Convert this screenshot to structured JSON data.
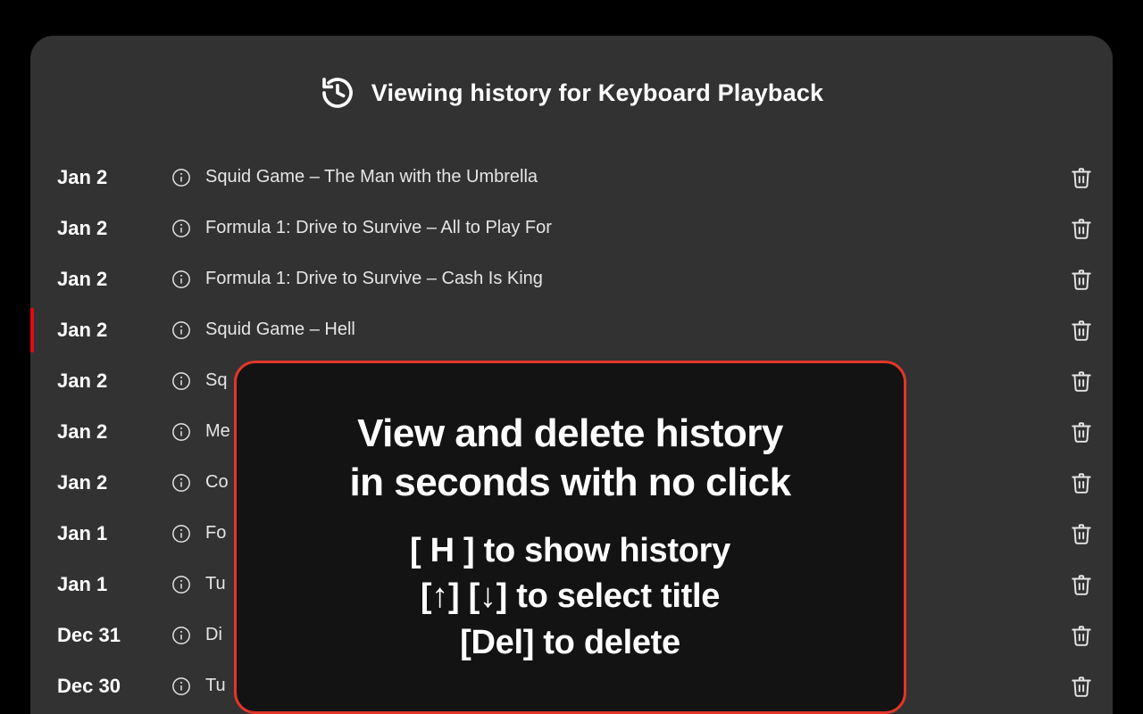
{
  "header": {
    "title": "Viewing history for Keyboard Playback"
  },
  "rows": [
    {
      "date": "Jan 2",
      "title": "Squid Game – The Man with the Umbrella",
      "selected": false
    },
    {
      "date": "Jan 2",
      "title": "Formula 1: Drive to Survive – All to Play For",
      "selected": false
    },
    {
      "date": "Jan 2",
      "title": "Formula 1: Drive to Survive – Cash Is King",
      "selected": false
    },
    {
      "date": "Jan 2",
      "title": "Squid Game – Hell",
      "selected": true
    },
    {
      "date": "Jan 2",
      "title": "Sq",
      "selected": false
    },
    {
      "date": "Jan 2",
      "title": "Me",
      "selected": false
    },
    {
      "date": "Jan 2",
      "title": "Co",
      "selected": false
    },
    {
      "date": "Jan 1",
      "title": "Fo",
      "selected": false
    },
    {
      "date": "Jan 1",
      "title": "Tu",
      "selected": false
    },
    {
      "date": "Dec 31",
      "title": "Di",
      "selected": false
    },
    {
      "date": "Dec 30",
      "title": "Tu",
      "selected": false
    }
  ],
  "popup": {
    "heading_line1": "View and delete history",
    "heading_line2": "in seconds with no click",
    "hint1": "[ H ] to show history",
    "hint2": "[↑] [↓] to select title",
    "hint3": "[Del] to delete"
  }
}
